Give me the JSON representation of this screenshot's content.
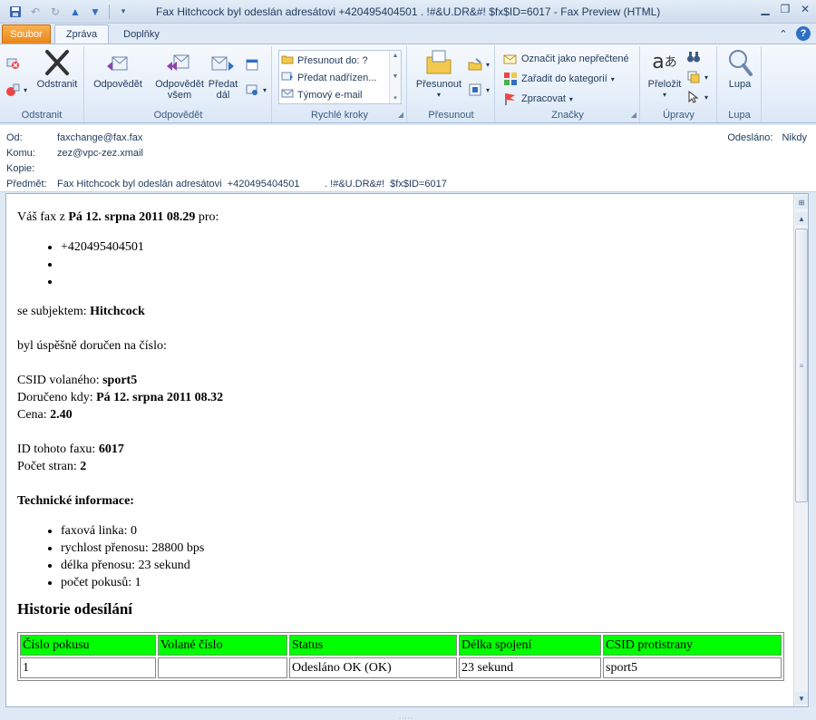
{
  "window": {
    "title": "Fax Hitchcock byl odeslán adresátovi  +420495404501         . !#&U.DR&#!  $fx$ID=6017  -  Fax Preview (HTML)"
  },
  "tabs": {
    "file": "Soubor",
    "message": "Zpráva",
    "addins": "Doplňky"
  },
  "ribbon": {
    "delete_group": {
      "label": "Odstranit",
      "delete": "Odstranit"
    },
    "respond_group": {
      "label": "Odpovědět",
      "reply": "Odpovědět",
      "reply_all_l1": "Odpovědět",
      "reply_all_l2": "všem",
      "forward_l1": "Předat",
      "forward_l2": "dál"
    },
    "quick_steps": {
      "label": "Rychlé kroky",
      "items": [
        "Přesunout do: ?",
        "Předat nadřízen...",
        "Týmový e-mail"
      ]
    },
    "move_group": {
      "label": "Přesunout",
      "move": "Přesunout"
    },
    "tags_group": {
      "label": "Značky",
      "mark_unread": "Označit jako nepřečtené",
      "categorize": "Zařadit do kategorií",
      "followup": "Zpracovat"
    },
    "edit_group": {
      "label": "Úpravy",
      "translate": "Přeložit"
    },
    "zoom_group": {
      "label": "Lupa",
      "zoom": "Lupa"
    }
  },
  "header": {
    "from_label": "Od:",
    "from": "faxchange@fax.fax",
    "to_label": "Komu:",
    "to": "zez@vpc-zez.xmail",
    "cc_label": "Kopie:",
    "cc": "",
    "subject_label": "Předmět:",
    "subject": "Fax Hitchcock byl odeslán adresátovi  +420495404501         . !#&U.DR&#!  $fx$ID=6017",
    "sent_label": "Odesláno:",
    "sent": "Nikdy"
  },
  "message": {
    "intro_prefix": "Váš fax z ",
    "intro_date": "Pá 12. srpna 2011 08.29",
    "intro_suffix": " pro:",
    "recipients": [
      "+420495404501",
      "",
      ""
    ],
    "subject_prefix": "se subjektem: ",
    "subject_value": "Hitchcock",
    "delivered_text": "byl úspěšně doručen na číslo:",
    "csid_label": "CSID volaného: ",
    "csid": "sport5",
    "delivered_label": "Doručeno kdy: ",
    "delivered_at": "Pá 12. srpna 2011 08.32",
    "price_label": "Cena: ",
    "price": "2.40",
    "fax_id_label": "ID tohoto faxu: ",
    "fax_id": "6017",
    "pages_label": "Počet stran: ",
    "pages": "2",
    "tech_heading": "Technické informace:",
    "tech_items": [
      "faxová linka: 0",
      "rychlost přenosu: 28800 bps",
      "délka přenosu: 23 sekund",
      "počet pokusů: 1"
    ],
    "history_heading": "Historie odesílání",
    "history_table": {
      "columns": [
        "Číslo pokusu",
        "Volané číslo",
        "Status",
        "Délka spojení",
        "CSID protistrany"
      ],
      "rows": [
        [
          "1",
          "",
          "Odesláno OK (OK)",
          "23 sekund",
          "sport5"
        ]
      ]
    }
  },
  "colors": {
    "table_header": "#00ff00",
    "file_tab": "#e9851a"
  }
}
